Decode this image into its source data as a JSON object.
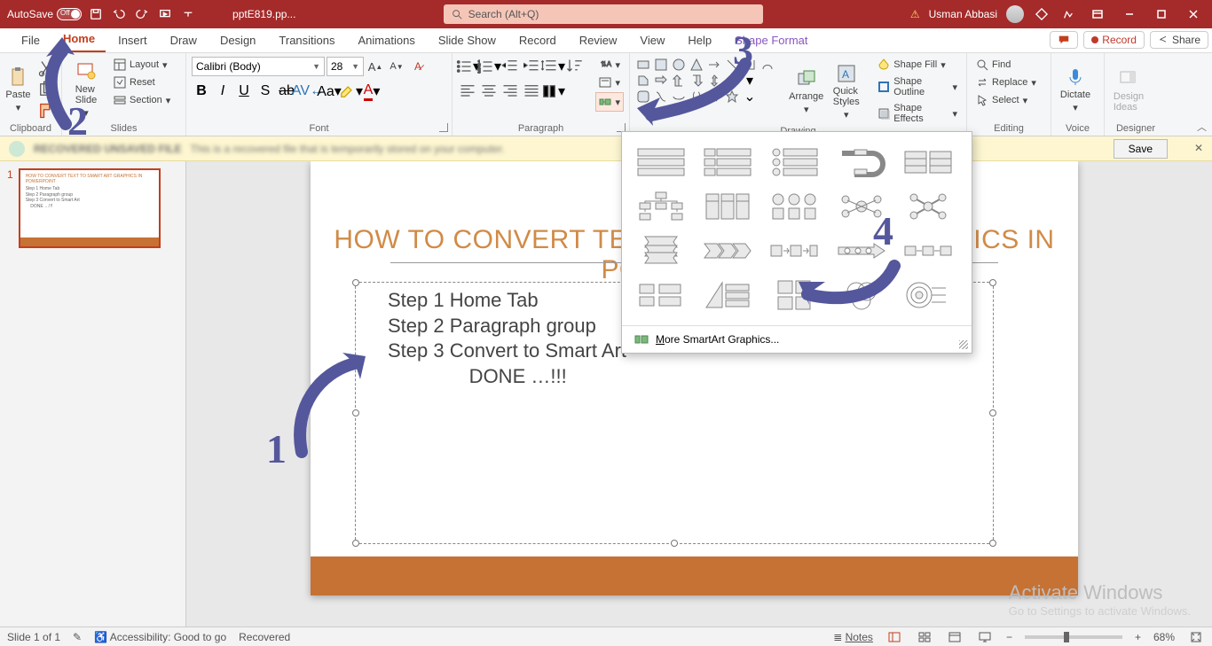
{
  "titlebar": {
    "autosave_label": "AutoSave",
    "autosave_state": "Off",
    "filename": "pptE819.pp...",
    "search_placeholder": "Search (Alt+Q)",
    "user_name": "Usman Abbasi"
  },
  "tabs": {
    "items": [
      "File",
      "Home",
      "Insert",
      "Draw",
      "Design",
      "Transitions",
      "Animations",
      "Slide Show",
      "Record",
      "Review",
      "View",
      "Help",
      "Shape Format"
    ],
    "active": "Home",
    "record_btn": "Record",
    "share_btn": "Share"
  },
  "ribbon": {
    "clipboard": {
      "label": "Clipboard",
      "paste": "Paste"
    },
    "slides": {
      "label": "Slides",
      "new_slide": "New\nSlide",
      "layout": "Layout",
      "reset": "Reset",
      "section": "Section"
    },
    "font": {
      "label": "Font",
      "family": "Calibri (Body)",
      "size": "28"
    },
    "paragraph": {
      "label": "Paragraph"
    },
    "drawing": {
      "label": "Drawing",
      "arrange": "Arrange",
      "quick_styles": "Quick\nStyles",
      "shape_fill": "Shape Fill",
      "shape_outline": "Shape Outline",
      "shape_effects": "Shape Effects"
    },
    "editing": {
      "label": "Editing",
      "find": "Find",
      "replace": "Replace",
      "select": "Select"
    },
    "voice": {
      "label": "Voice",
      "dictate": "Dictate"
    },
    "designer": {
      "label": "Designer",
      "design_ideas": "Design\nIdeas"
    }
  },
  "messagebar": {
    "title_blur": "RECOVERED UNSAVED FILE",
    "text_blur": "This is a recovered file that is temporarily stored on your computer.",
    "save": "Save"
  },
  "thumb": {
    "number": "1"
  },
  "slide": {
    "title": "HOW TO CONVERT TEXT TO SMART ART GRAPHICS IN POWERPOINT",
    "lines": [
      "Step 1  Home Tab",
      "Step 2  Paragraph group",
      "Step 3   Convert to Smart Art",
      "               DONE …!!!"
    ]
  },
  "flyout": {
    "more": "More SmartArt Graphics..."
  },
  "activate": {
    "line1": "Activate Windows",
    "line2": "Go to Settings to activate Windows."
  },
  "statusbar": {
    "slide_of": "Slide 1 of 1",
    "accessibility": "Accessibility: Good to go",
    "recovered": "Recovered",
    "notes": "Notes",
    "zoom": "68%"
  },
  "annotations": {
    "n1": "1",
    "n2": "2",
    "n3": "3",
    "n4": "4"
  }
}
